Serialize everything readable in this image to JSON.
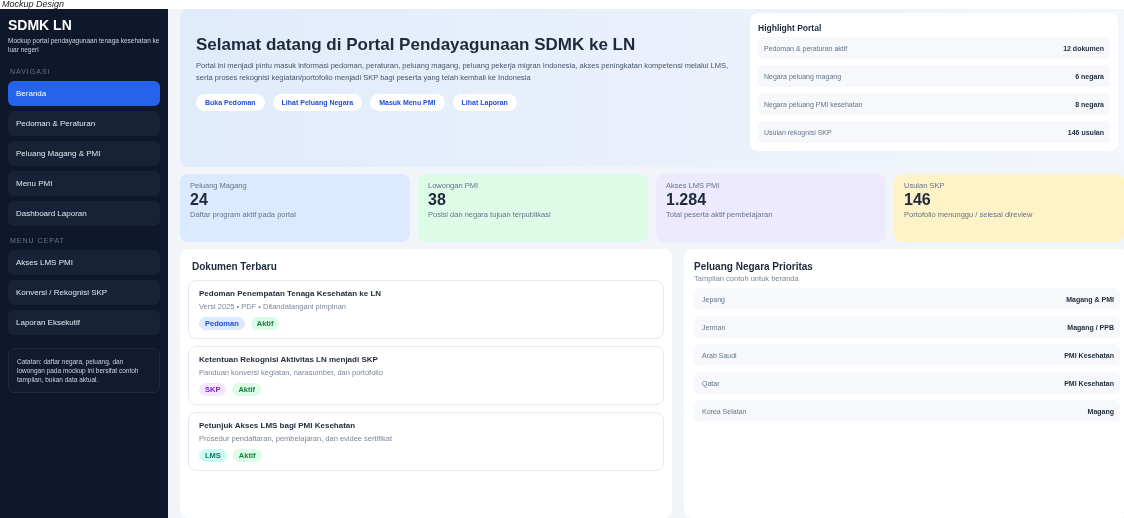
{
  "caption": "Mockup Design",
  "sidebar": {
    "brand": "SDMK LN",
    "tagline": "Mockup portal pendayagunaan tenaga kesehatan ke luar negeri",
    "sections": [
      {
        "heading": "NAVIGASI",
        "items": [
          {
            "label": "Beranda",
            "selected": true
          },
          {
            "label": "Pedoman & Peraturan",
            "selected": false
          },
          {
            "label": "Peluang Magang & PMI",
            "selected": false
          },
          {
            "label": "Menu PMI",
            "selected": false
          },
          {
            "label": "Dashboard Laporan",
            "selected": false
          }
        ]
      },
      {
        "heading": "MENU CEPAT",
        "items": [
          {
            "label": "Akses LMS PMI",
            "selected": false
          },
          {
            "label": "Konversi / Rekognisi SKP",
            "selected": false
          },
          {
            "label": "Laporan Eksekutif",
            "selected": false
          }
        ]
      }
    ],
    "note": "Catatan: daftar negara, peluang, dan lowongan pada mockup ini bersifat contoh tampilan, bukan data aktual."
  },
  "hero": {
    "title": "Selamat datang di Portal Pendayagunaan SDMK ke LN",
    "description": "Portal ini menjadi pintu masuk informasi pedoman, peraturan, peluang magang, peluang pekerja migran Indonesia, akses peningkatan kompetensi melalui LMS, serta proses rekognisi kegiatan/portofolio menjadi SKP bagi peserta yang telah kembali ke Indonesia",
    "buttons": [
      "Buka Pedoman",
      "Lihat Peluang Negara",
      "Masuk Menu PMI",
      "Lihat Laporan"
    ]
  },
  "highlight": {
    "title": "Highlight Portal",
    "rows": [
      {
        "label": "Pedoman & peraturan aktif",
        "value": "12 dokumen"
      },
      {
        "label": "Negara peluang magang",
        "value": "6 negara"
      },
      {
        "label": "Negara peluang PMI kesehatan",
        "value": "8 negara"
      },
      {
        "label": "Usulan rekognisi SKP",
        "value": "146 usulan"
      }
    ]
  },
  "stats": [
    {
      "label": "Peluang Magang",
      "value": "24",
      "caption": "Daftar program aktif pada portal",
      "color": "#dbeafe"
    },
    {
      "label": "Lowongan PMI",
      "value": "38",
      "caption": "Posisi dan negara tujuan terpublikasi",
      "color": "#dcfce7"
    },
    {
      "label": "Akses LMS PMI",
      "value": "1.284",
      "caption": "Total peserta aktif pembelajaran",
      "color": "#ede9fe"
    },
    {
      "label": "Usulan SKP",
      "value": "146",
      "caption": "Portofolio menunggu / selesai direview",
      "color": "#fef3c7"
    }
  ],
  "documents": {
    "title": "Dokumen Terbaru",
    "items": [
      {
        "title": "Pedoman Penempatan Tenaga Kesehatan ke LN",
        "meta": "Versi 2025 • PDF • Ditandatangani pimpinan",
        "tags": [
          {
            "label": "Pedoman",
            "color": "#dbeafe"
          },
          {
            "label": "Aktif",
            "color": "#dcfce7"
          }
        ]
      },
      {
        "title": "Ketentuan Rekognisi Aktivitas LN menjadi SKP",
        "meta": "Panduan konversi kegiatan, narasumber, dan portofolio",
        "tags": [
          {
            "label": "SKP",
            "color": "#f3e8ff"
          },
          {
            "label": "Aktif",
            "color": "#dcfce7"
          }
        ]
      },
      {
        "title": "Petunjuk Akses LMS bagi PMI Kesehatan",
        "meta": "Prosedur pendaftaran, pembelajaran, dan evidee sertifikat",
        "tags": [
          {
            "label": "LMS",
            "color": "#ccfbf1"
          },
          {
            "label": "Aktif",
            "color": "#dcfce7"
          }
        ]
      }
    ]
  },
  "countries": {
    "title": "Peluang Negara Prioritas",
    "subtitle": "Tampilan contoh untuk beranda",
    "rows": [
      {
        "country": "Jepang",
        "type": "Magang & PMI"
      },
      {
        "country": "Jerman",
        "type": "Magang / PPB"
      },
      {
        "country": "Arab Saudi",
        "type": "PMI Kesehatan"
      },
      {
        "country": "Qatar",
        "type": "PMI Kesehatan"
      },
      {
        "country": "Korea Selatan",
        "type": "Magang"
      }
    ]
  }
}
